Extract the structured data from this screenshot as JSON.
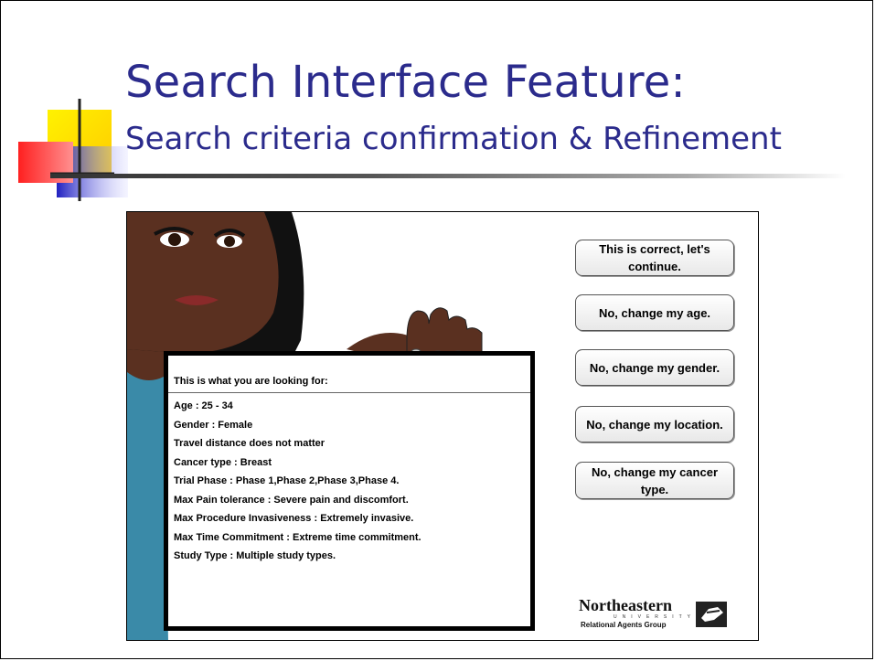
{
  "slide": {
    "title": "Search Interface Feature:",
    "subtitle": "Search criteria confirmation & Refinement"
  },
  "board": {
    "heading": "This is what you are looking for:",
    "criteria": [
      "Age : 25 - 34",
      "Gender : Female",
      "Travel distance does not matter",
      "Cancer type : Breast",
      "Trial Phase : Phase 1,Phase 2,Phase 3,Phase 4.",
      "Max Pain tolerance : Severe pain and discomfort.",
      "Max Procedure Invasiveness : Extremely invasive.",
      "Max Time Commitment : Extreme time commitment.",
      "Study Type : Multiple study types."
    ]
  },
  "buttons": {
    "confirm": "This is correct, let's continue.",
    "change_age": "No, change my age.",
    "change_gender": "No, change my gender.",
    "change_location": "No, change my location.",
    "change_cancer": "No, change my cancer type."
  },
  "logo": {
    "name": "Northeastern",
    "university": "UNIVERSITY",
    "group": "Relational Agents Group",
    "icon": "hand-logo-icon"
  },
  "colors": {
    "title": "#2b2b8c",
    "deco_yellow": "#ffd800",
    "deco_red": "#ff3030",
    "deco_blue": "#3030c8",
    "skin": "#5a3020",
    "shirt": "#3a8aa8"
  }
}
